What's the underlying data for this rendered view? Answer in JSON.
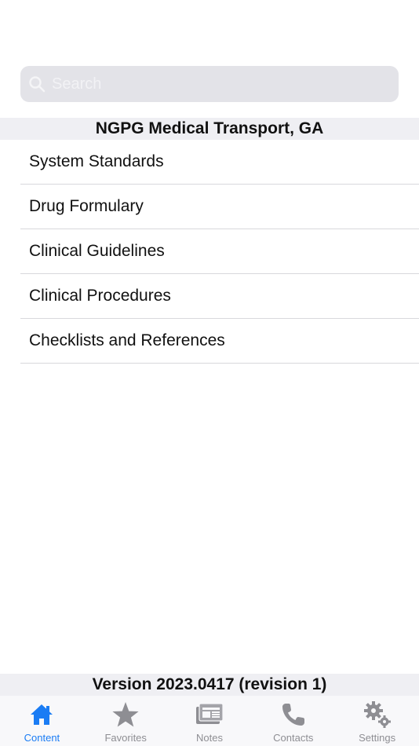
{
  "search": {
    "placeholder": "Search"
  },
  "section": {
    "title": "NGPG Medical Transport, GA"
  },
  "items": [
    {
      "label": "System Standards"
    },
    {
      "label": "Drug Formulary"
    },
    {
      "label": "Clinical Guidelines"
    },
    {
      "label": "Clinical Procedures"
    },
    {
      "label": "Checklists and References"
    }
  ],
  "footer": {
    "version": "Version 2023.0417 (revision 1)"
  },
  "tabs": [
    {
      "label": "Content",
      "icon": "house-icon",
      "active": true
    },
    {
      "label": "Favorites",
      "icon": "star-icon",
      "active": false
    },
    {
      "label": "Notes",
      "icon": "notes-icon",
      "active": false
    },
    {
      "label": "Contacts",
      "icon": "phone-icon",
      "active": false
    },
    {
      "label": "Settings",
      "icon": "gear-icon",
      "active": false
    }
  ],
  "colors": {
    "accent": "#1a7cf4",
    "inactive": "#8e8e93",
    "header_bg": "#efeff3"
  }
}
